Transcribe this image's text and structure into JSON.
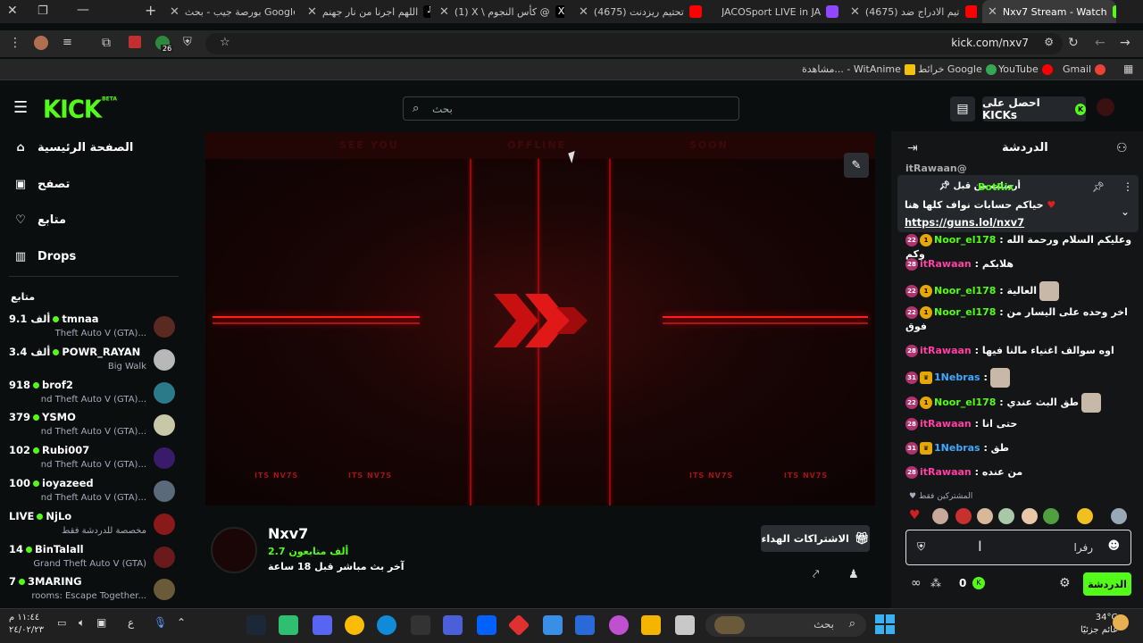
{
  "browser": {
    "tabs": [
      {
        "label": "بورصة جيب - بحث Google",
        "color": "#4285f4"
      },
      {
        "label": "اللهم اجرنا من نار جهنم",
        "color": "#ffffff"
      },
      {
        "label": "(1) X \\ كأس النجوم @",
        "color": "#ffffff"
      },
      {
        "label": "(4675) تحتيم ريزدنت",
        "color": "#ff0000"
      },
      {
        "label": "JACOSport LIVE in JA",
        "color": "#9146ff"
      },
      {
        "label": "(4675) تيم الادراج ضد",
        "color": "#ff0000"
      },
      {
        "label": "Nxv7 Stream - Watch",
        "color": "#53fc18"
      }
    ],
    "url": "kick.com/nxv7",
    "extension_badge": "26",
    "bookmarks": [
      {
        "label": "Gmail",
        "color": "#ea4335"
      },
      {
        "label": "YouTube",
        "color": "#ff0000"
      },
      {
        "label": "خرائط Google",
        "color": "#34a853"
      },
      {
        "label": "مشاهدة... - WitAnime",
        "color": "#f4c20d"
      }
    ]
  },
  "kick": {
    "logo": "KICK",
    "logo_sup": "BETA",
    "search_placeholder": "بحث",
    "get_kicks": "احصل على KICKs",
    "nav": [
      {
        "label": "الصفحة الرئيسية",
        "icon": "home-icon",
        "glyph": "⌂"
      },
      {
        "label": "تصفح",
        "icon": "browse-icon",
        "glyph": "▣"
      },
      {
        "label": "متابع",
        "icon": "heart-icon",
        "glyph": "♡"
      },
      {
        "label": "Drops",
        "icon": "drops-icon",
        "glyph": "▥"
      }
    ],
    "following_header": "متابع",
    "following": [
      {
        "viewers": "9.1 ألف",
        "name": "tmnaa",
        "game": "Theft Auto V (GTA)...",
        "avatar": "#5a2a20"
      },
      {
        "viewers": "3.4 ألف",
        "name": "POWR_RAYAN",
        "game": "Big Walk",
        "avatar": "#b8b8b8"
      },
      {
        "viewers": "918",
        "name": "brof2",
        "game": "nd Theft Auto V (GTA)...",
        "avatar": "#2a7a8a"
      },
      {
        "viewers": "379",
        "name": "YSMO",
        "game": "nd Theft Auto V (GTA)...",
        "avatar": "#c8c8a8"
      },
      {
        "viewers": "102",
        "name": "Rubi007",
        "game": "nd Theft Auto V (GTA)...",
        "avatar": "#3a1a6a"
      },
      {
        "viewers": "100",
        "name": "ioyazeed",
        "game": "nd Theft Auto V (GTA)...",
        "avatar": "#5a6a7a"
      },
      {
        "viewers": "LIVE",
        "name": "NjLo",
        "game": "مخصصة للدردشة فقط",
        "avatar": "#8a1a1a"
      },
      {
        "viewers": "14",
        "name": "BinTalall",
        "game": "Grand Theft Auto V (GTA)",
        "avatar": "#6a1a1a"
      },
      {
        "viewers": "7",
        "name": "3MARING",
        "game": "rooms: Escape Together...",
        "avatar": "#6a5a3a"
      }
    ]
  },
  "video": {
    "top_texts": [
      "SEE YOU",
      "OFFLINE",
      "SOON"
    ],
    "watermark": "ITS NV7S"
  },
  "channel": {
    "name": "Nxv7",
    "followers": "2.7 ألف متابعون",
    "last_live": "آخر بث مباشر قبل 18 ساعة",
    "gift_subs": "الاشتراكات الهداء"
  },
  "chat": {
    "title": "الدردشة",
    "top_user": "itRawaan@",
    "pinned": {
      "header": "أرسلت من قبل",
      "user": "BotRix",
      "line1": "حياكم حسابات نواف كلها هنا",
      "link": "https://guns.lol/nxv7"
    },
    "messages": [
      {
        "sub": "22",
        "vip": "1",
        "user": "Noor_el178",
        "ucolor": "#53fc18",
        "text": ": وعليكم السلام ورحمة الله وكم",
        "pic": false
      },
      {
        "sub": "28",
        "vip": "",
        "user": "itRawaan",
        "ucolor": "#ff3fa4",
        "text": ": هلابكم",
        "pic": false
      },
      {
        "sub": "22",
        "vip": "1",
        "user": "Noor_el178",
        "ucolor": "#53fc18",
        "text": ": العالية",
        "pic": true
      },
      {
        "sub": "22",
        "vip": "1",
        "user": "Noor_el178",
        "ucolor": "#53fc18",
        "text": ": اخر وحده على اليسار من فوق",
        "pic": false
      },
      {
        "sub": "28",
        "vip": "",
        "user": "itRawaan",
        "ucolor": "#ff3fa4",
        "text": ": اوه سوالف اغنياء مالنا فيها",
        "pic": false
      },
      {
        "sub": "31",
        "vip": "c",
        "user": "1Nebras",
        "ucolor": "#3fa9ff",
        "text": ":",
        "pic": true
      },
      {
        "sub": "22",
        "vip": "1",
        "user": "Noor_el178",
        "ucolor": "#53fc18",
        "text": ": طق البث عندي",
        "pic": true
      },
      {
        "sub": "28",
        "vip": "",
        "user": "itRawaan",
        "ucolor": "#ff3fa4",
        "text": ": حتى انا",
        "pic": false
      },
      {
        "sub": "31",
        "vip": "c",
        "user": "1Nebras",
        "ucolor": "#3fa9ff",
        "text": ": طق",
        "pic": false
      },
      {
        "sub": "28",
        "vip": "",
        "user": "itRawaan",
        "ucolor": "#ff3fa4",
        "text": ": من عنده",
        "pic": false
      }
    ],
    "subs_only_label": "المشتركين فقط",
    "input_value": "رفرا",
    "send_label": "الدردشة",
    "kicks_count": "0"
  },
  "taskbar": {
    "search_placeholder": "بحث",
    "time": "١١:٤٤ م",
    "date": "٢٤/٠٢/٢٣",
    "temp": "34°C",
    "weather": "غائم جزئيًا",
    "lang": "ع"
  }
}
